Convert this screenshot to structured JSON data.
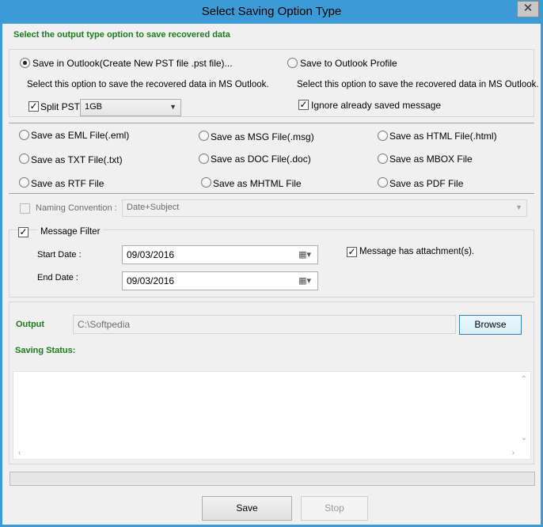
{
  "window": {
    "title": "Select Saving Option Type",
    "close_label": "✕"
  },
  "header": {
    "instruction": "Select the output type option to save recovered data"
  },
  "outlook_options": {
    "save_in_outlook_label": "Save in Outlook(Create New PST file .pst file)...",
    "save_in_outlook_desc": "Select this option to save the recovered data in MS Outlook.",
    "split_pst_label": "Split PST",
    "split_pst_checked": true,
    "split_size_value": "1GB",
    "save_to_profile_label": "Save to Outlook Profile",
    "save_to_profile_desc": "Select this option to save the recovered data in MS Outlook.",
    "ignore_saved_label": "Ignore already saved message",
    "ignore_saved_checked": true
  },
  "formats": {
    "eml": "Save as EML File(.eml)",
    "msg": "Save as MSG File(.msg)",
    "html": "Save as HTML File(.html)",
    "txt": "Save as TXT File(.txt)",
    "doc": "Save as DOC File(.doc)",
    "mbox": "Save as MBOX File",
    "rtf": "Save as RTF File",
    "mhtml": "Save as MHTML File",
    "pdf": "Save as PDF File"
  },
  "naming": {
    "label": "Naming Convention :",
    "value": "Date+Subject"
  },
  "filter": {
    "label": "Message Filter",
    "checked": true,
    "start_label": "Start Date :",
    "start_value": "09/03/2016",
    "end_label": "End Date :",
    "end_value": "09/03/2016",
    "attachment_label": "Message has attachment(s).",
    "attachment_checked": true
  },
  "output": {
    "label": "Output",
    "path": "C:\\Softpedia",
    "browse_label": "Browse",
    "status_label": "Saving Status:"
  },
  "actions": {
    "save_label": "Save",
    "stop_label": "Stop"
  },
  "icons": {
    "calendar": "calendar-icon",
    "dropdown": "chevron-down-icon",
    "close": "close-icon"
  }
}
